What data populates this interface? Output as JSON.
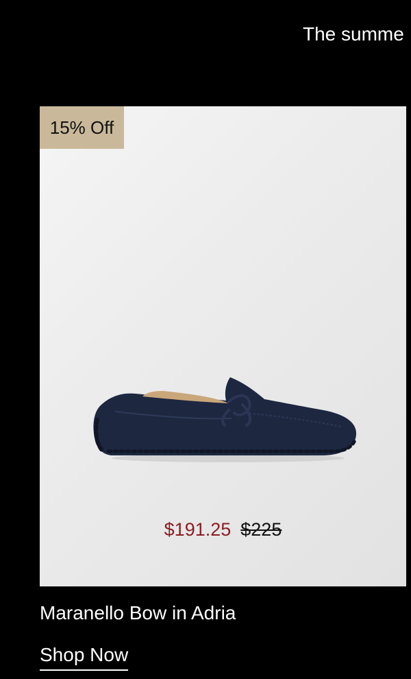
{
  "announcement": {
    "text": "The summe"
  },
  "product": {
    "badge": "15% Off",
    "price_sale": "$191.25",
    "price_original": "$225",
    "title": "Maranello Bow in Adria",
    "cta": "Shop Now",
    "image_icon": "navy-suede-driving-loafer",
    "colors": {
      "badge_bg": "#c9b99a",
      "sale_price": "#8b1e23",
      "shoe": "#1d2740"
    }
  }
}
